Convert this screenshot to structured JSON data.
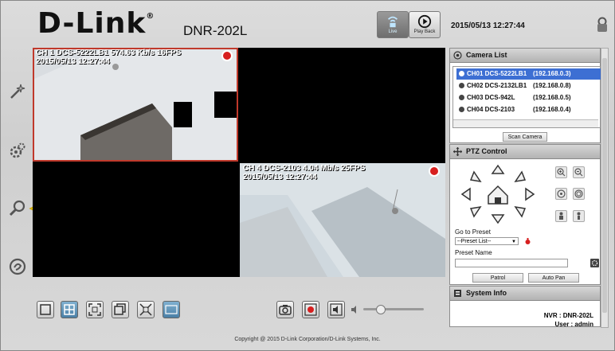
{
  "header": {
    "brand": "D-Link",
    "brand_mark": "®",
    "model": "DNR-202L",
    "datetime": "2015/05/13 12:27:44",
    "modes": [
      {
        "label": "Live",
        "active": true
      },
      {
        "label": "Play Back",
        "active": false
      }
    ]
  },
  "cameras_view": [
    {
      "overlay_line1": "CH 1 DCS-5222LB1 574.63 Kb/s  16FPS",
      "overlay_line2": "2015/05/13 12:27:44"
    },
    {
      "overlay_line1": "",
      "overlay_line2": ""
    },
    {
      "overlay_line1": "",
      "overlay_line2": ""
    },
    {
      "overlay_line1": "CH 4 DCS-2103 4.04 Mb/s  25FPS",
      "overlay_line2": "2015/05/13 12:27:44"
    }
  ],
  "camera_list": {
    "title": "Camera List",
    "items": [
      {
        "name": "CH01 DCS-5222LB1",
        "ip": "(192.168.0.3)",
        "selected": true
      },
      {
        "name": "CH02 DCS-2132LB1",
        "ip": "(192.168.0.8)",
        "selected": false
      },
      {
        "name": "CH03 DCS-942L",
        "ip": "(192.168.0.5)",
        "selected": false
      },
      {
        "name": "CH04 DCS-2103",
        "ip": "(192.168.0.4)",
        "selected": false
      }
    ],
    "scan_label": "Scan Camera"
  },
  "ptz": {
    "title": "PTZ Control",
    "goto_label": "Go to Preset",
    "preset_select": "--Preset List--",
    "preset_name_label": "Preset Name",
    "preset_name_value": "",
    "patrol_label": "Patrol",
    "autopan_label": "Auto Pan"
  },
  "system_info": {
    "title": "System Info",
    "nvr": "NVR : DNR-202L",
    "user": "User : admin"
  },
  "footer": {
    "copyright": "Copyright @ 2015 D-Link Corporation/D-Link Systems, Inc."
  },
  "colors": {
    "accent": "#3d6fd3",
    "record": "#d71f1f",
    "arrow": "#ffe400",
    "selection_border": "#c0392b"
  },
  "icons": {
    "sidebar": [
      "wizard-icon",
      "settings-icon",
      "search-icon",
      "help-icon"
    ],
    "bottombar": [
      "layout-1x1-icon",
      "layout-2x2-icon",
      "full-screen-icon",
      "sequence-icon",
      "fit-screen-icon",
      "osd-icon",
      "snapshot-icon",
      "record-icon",
      "audio-icon",
      "volume-icon"
    ]
  }
}
